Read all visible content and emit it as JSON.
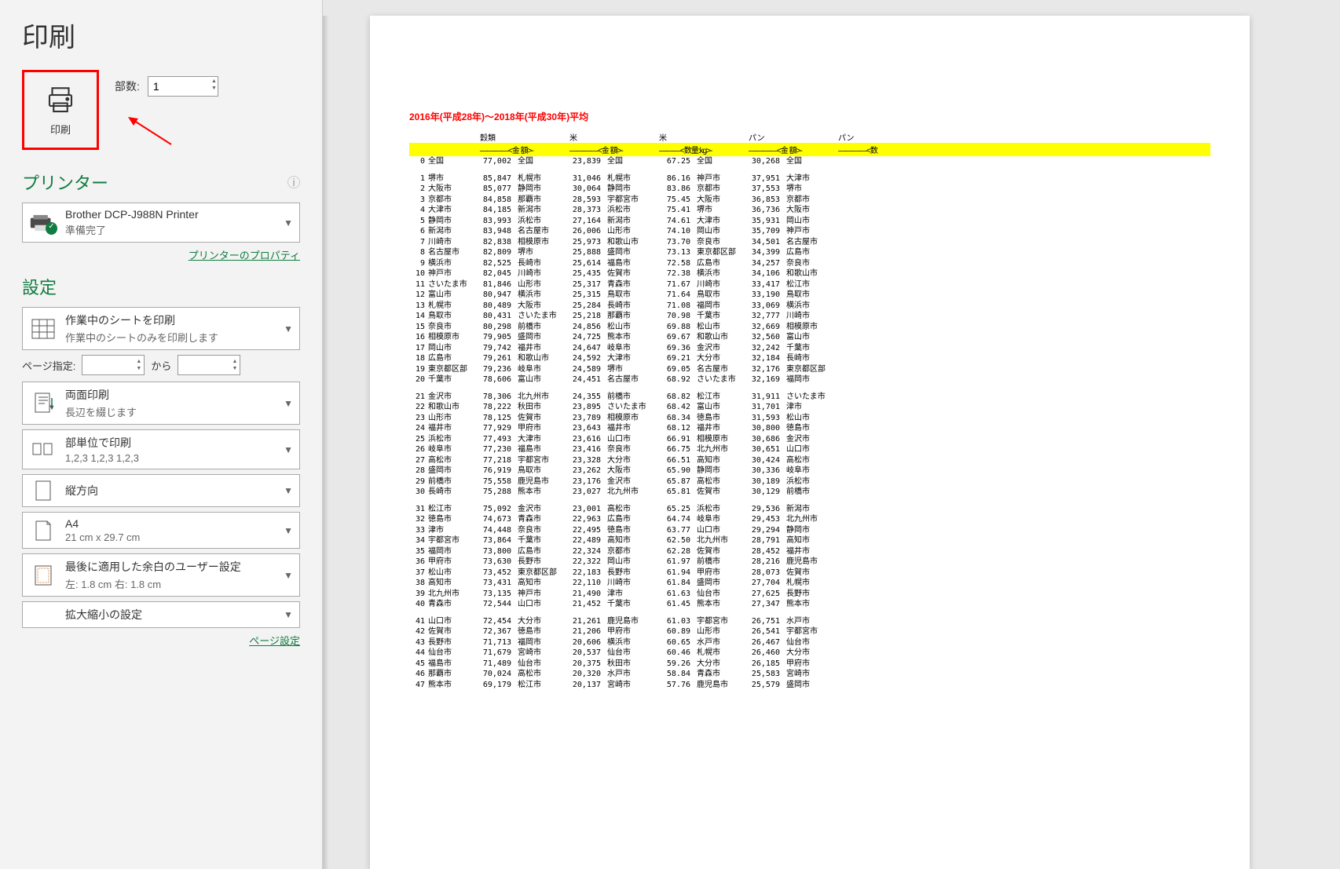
{
  "page_title": "印刷",
  "print_button_label": "印刷",
  "copies": {
    "label": "部数:",
    "value": "1"
  },
  "printer_section": {
    "title": "プリンター",
    "name": "Brother DCP-J988N Printer",
    "status": "準備完了",
    "properties_link": "プリンターのプロパティ"
  },
  "settings_section": {
    "title": "設定",
    "items": [
      {
        "title": "作業中のシートを印刷",
        "sub": "作業中のシートのみを印刷します"
      }
    ],
    "page_range": {
      "label": "ページ指定:",
      "to_label": "から",
      "from": "",
      "to": ""
    },
    "duplex": {
      "title": "両面印刷",
      "sub": "長辺を綴じます"
    },
    "collate": {
      "title": "部単位で印刷",
      "sub": "1,2,3    1,2,3    1,2,3"
    },
    "orientation": {
      "title": "縦方向"
    },
    "paper": {
      "title": "A4",
      "sub": "21 cm x 29.7 cm"
    },
    "margins": {
      "title": "最後に適用した余白のユーザー設定",
      "sub": "左:  1.8 cm    右:  1.8 cm"
    },
    "scaling": {
      "title": "拡大縮小の設定"
    },
    "page_setup_link": "ページ設定"
  },
  "report": {
    "title": "2016年(平成28年)～2018年(平成30年)平均",
    "header_top": [
      "穀類",
      "米",
      "米",
      "パン",
      "パン"
    ],
    "header_yellow": [
      "――――<金 額>-",
      "――――<金 額>-",
      "―――<数量:kg>-",
      "――――<金 額>-",
      "――――<数"
    ],
    "row0": {
      "n": "0",
      "c1": "全国",
      "v1": "77,002",
      "c2": "全国",
      "v2": "23,839",
      "c3": "全国",
      "v3": "67.25",
      "c4": "全国",
      "v4": "30,268",
      "c5": "全国"
    },
    "groups": [
      [
        {
          "n": "1",
          "c1": "堺市",
          "v1": "85,847",
          "c2": "札幌市",
          "v2": "31,046",
          "c3": "札幌市",
          "v3": "86.16",
          "c4": "神戸市",
          "v4": "37,951",
          "c5": "大津市"
        },
        {
          "n": "2",
          "c1": "大阪市",
          "v1": "85,077",
          "c2": "静岡市",
          "v2": "30,064",
          "c3": "静岡市",
          "v3": "83.86",
          "c4": "京都市",
          "v4": "37,553",
          "c5": "堺市"
        },
        {
          "n": "3",
          "c1": "京都市",
          "v1": "84,858",
          "c2": "那覇市",
          "v2": "28,593",
          "c3": "宇都宮市",
          "v3": "75.45",
          "c4": "大阪市",
          "v4": "36,853",
          "c5": "京都市"
        },
        {
          "n": "4",
          "c1": "大津市",
          "v1": "84,185",
          "c2": "新潟市",
          "v2": "28,373",
          "c3": "浜松市",
          "v3": "75.41",
          "c4": "堺市",
          "v4": "36,736",
          "c5": "大阪市"
        },
        {
          "n": "5",
          "c1": "静岡市",
          "v1": "83,993",
          "c2": "浜松市",
          "v2": "27,164",
          "c3": "新潟市",
          "v3": "74.61",
          "c4": "大津市",
          "v4": "35,931",
          "c5": "岡山市"
        },
        {
          "n": "6",
          "c1": "新潟市",
          "v1": "83,948",
          "c2": "名古屋市",
          "v2": "26,006",
          "c3": "山形市",
          "v3": "74.10",
          "c4": "岡山市",
          "v4": "35,709",
          "c5": "神戸市"
        },
        {
          "n": "7",
          "c1": "川崎市",
          "v1": "82,838",
          "c2": "相模原市",
          "v2": "25,973",
          "c3": "和歌山市",
          "v3": "73.70",
          "c4": "奈良市",
          "v4": "34,501",
          "c5": "名古屋市"
        },
        {
          "n": "8",
          "c1": "名古屋市",
          "v1": "82,809",
          "c2": "堺市",
          "v2": "25,888",
          "c3": "盛岡市",
          "v3": "73.13",
          "c4": "東京都区部",
          "v4": "34,399",
          "c5": "広島市"
        },
        {
          "n": "9",
          "c1": "横浜市",
          "v1": "82,525",
          "c2": "長崎市",
          "v2": "25,614",
          "c3": "福島市",
          "v3": "72.58",
          "c4": "広島市",
          "v4": "34,257",
          "c5": "奈良市"
        },
        {
          "n": "10",
          "c1": "神戸市",
          "v1": "82,045",
          "c2": "川崎市",
          "v2": "25,435",
          "c3": "佐賀市",
          "v3": "72.38",
          "c4": "横浜市",
          "v4": "34,106",
          "c5": "和歌山市"
        },
        {
          "n": "11",
          "c1": "さいたま市",
          "v1": "81,846",
          "c2": "山形市",
          "v2": "25,317",
          "c3": "青森市",
          "v3": "71.67",
          "c4": "川崎市",
          "v4": "33,417",
          "c5": "松江市"
        },
        {
          "n": "12",
          "c1": "富山市",
          "v1": "80,947",
          "c2": "横浜市",
          "v2": "25,315",
          "c3": "鳥取市",
          "v3": "71.64",
          "c4": "鳥取市",
          "v4": "33,190",
          "c5": "鳥取市"
        },
        {
          "n": "13",
          "c1": "札幌市",
          "v1": "80,489",
          "c2": "大阪市",
          "v2": "25,284",
          "c3": "長崎市",
          "v3": "71.08",
          "c4": "福岡市",
          "v4": "33,069",
          "c5": "横浜市"
        },
        {
          "n": "14",
          "c1": "鳥取市",
          "v1": "80,431",
          "c2": "さいたま市",
          "v2": "25,218",
          "c3": "那覇市",
          "v3": "70.98",
          "c4": "千葉市",
          "v4": "32,777",
          "c5": "川崎市"
        },
        {
          "n": "15",
          "c1": "奈良市",
          "v1": "80,298",
          "c2": "前橋市",
          "v2": "24,856",
          "c3": "松山市",
          "v3": "69.88",
          "c4": "松山市",
          "v4": "32,669",
          "c5": "相模原市"
        },
        {
          "n": "16",
          "c1": "相模原市",
          "v1": "79,905",
          "c2": "盛岡市",
          "v2": "24,725",
          "c3": "熊本市",
          "v3": "69.67",
          "c4": "和歌山市",
          "v4": "32,560",
          "c5": "富山市"
        },
        {
          "n": "17",
          "c1": "岡山市",
          "v1": "79,742",
          "c2": "福井市",
          "v2": "24,647",
          "c3": "岐阜市",
          "v3": "69.36",
          "c4": "金沢市",
          "v4": "32,242",
          "c5": "千葉市"
        },
        {
          "n": "18",
          "c1": "広島市",
          "v1": "79,261",
          "c2": "和歌山市",
          "v2": "24,592",
          "c3": "大津市",
          "v3": "69.21",
          "c4": "大分市",
          "v4": "32,184",
          "c5": "長崎市"
        },
        {
          "n": "19",
          "c1": "東京都区部",
          "v1": "79,236",
          "c2": "岐阜市",
          "v2": "24,589",
          "c3": "堺市",
          "v3": "69.05",
          "c4": "名古屋市",
          "v4": "32,176",
          "c5": "東京都区部"
        },
        {
          "n": "20",
          "c1": "千葉市",
          "v1": "78,606",
          "c2": "富山市",
          "v2": "24,451",
          "c3": "名古屋市",
          "v3": "68.92",
          "c4": "さいたま市",
          "v4": "32,169",
          "c5": "福岡市"
        }
      ],
      [
        {
          "n": "21",
          "c1": "金沢市",
          "v1": "78,306",
          "c2": "北九州市",
          "v2": "24,355",
          "c3": "前橋市",
          "v3": "68.82",
          "c4": "松江市",
          "v4": "31,911",
          "c5": "さいたま市"
        },
        {
          "n": "22",
          "c1": "和歌山市",
          "v1": "78,222",
          "c2": "秋田市",
          "v2": "23,895",
          "c3": "さいたま市",
          "v3": "68.42",
          "c4": "富山市",
          "v4": "31,701",
          "c5": "津市"
        },
        {
          "n": "23",
          "c1": "山形市",
          "v1": "78,125",
          "c2": "佐賀市",
          "v2": "23,789",
          "c3": "相模原市",
          "v3": "68.34",
          "c4": "徳島市",
          "v4": "31,593",
          "c5": "松山市"
        },
        {
          "n": "24",
          "c1": "福井市",
          "v1": "77,929",
          "c2": "甲府市",
          "v2": "23,643",
          "c3": "福井市",
          "v3": "68.12",
          "c4": "福井市",
          "v4": "30,800",
          "c5": "徳島市"
        },
        {
          "n": "25",
          "c1": "浜松市",
          "v1": "77,493",
          "c2": "大津市",
          "v2": "23,616",
          "c3": "山口市",
          "v3": "66.91",
          "c4": "相模原市",
          "v4": "30,686",
          "c5": "金沢市"
        },
        {
          "n": "26",
          "c1": "岐阜市",
          "v1": "77,230",
          "c2": "福島市",
          "v2": "23,416",
          "c3": "奈良市",
          "v3": "66.75",
          "c4": "北九州市",
          "v4": "30,651",
          "c5": "山口市"
        },
        {
          "n": "27",
          "c1": "高松市",
          "v1": "77,218",
          "c2": "宇都宮市",
          "v2": "23,328",
          "c3": "大分市",
          "v3": "66.51",
          "c4": "高知市",
          "v4": "30,424",
          "c5": "高松市"
        },
        {
          "n": "28",
          "c1": "盛岡市",
          "v1": "76,919",
          "c2": "鳥取市",
          "v2": "23,262",
          "c3": "大阪市",
          "v3": "65.90",
          "c4": "静岡市",
          "v4": "30,336",
          "c5": "岐阜市"
        },
        {
          "n": "29",
          "c1": "前橋市",
          "v1": "75,558",
          "c2": "鹿児島市",
          "v2": "23,176",
          "c3": "金沢市",
          "v3": "65.87",
          "c4": "高松市",
          "v4": "30,189",
          "c5": "浜松市"
        },
        {
          "n": "30",
          "c1": "長崎市",
          "v1": "75,288",
          "c2": "熊本市",
          "v2": "23,027",
          "c3": "北九州市",
          "v3": "65.81",
          "c4": "佐賀市",
          "v4": "30,129",
          "c5": "前橋市"
        }
      ],
      [
        {
          "n": "31",
          "c1": "松江市",
          "v1": "75,092",
          "c2": "金沢市",
          "v2": "23,001",
          "c3": "高松市",
          "v3": "65.25",
          "c4": "浜松市",
          "v4": "29,536",
          "c5": "新潟市"
        },
        {
          "n": "32",
          "c1": "徳島市",
          "v1": "74,673",
          "c2": "青森市",
          "v2": "22,963",
          "c3": "広島市",
          "v3": "64.74",
          "c4": "岐阜市",
          "v4": "29,453",
          "c5": "北九州市"
        },
        {
          "n": "33",
          "c1": "津市",
          "v1": "74,448",
          "c2": "奈良市",
          "v2": "22,495",
          "c3": "徳島市",
          "v3": "63.77",
          "c4": "山口市",
          "v4": "29,294",
          "c5": "静岡市"
        },
        {
          "n": "34",
          "c1": "宇都宮市",
          "v1": "73,864",
          "c2": "千葉市",
          "v2": "22,489",
          "c3": "高知市",
          "v3": "62.50",
          "c4": "北九州市",
          "v4": "28,791",
          "c5": "高知市"
        },
        {
          "n": "35",
          "c1": "福岡市",
          "v1": "73,800",
          "c2": "広島市",
          "v2": "22,324",
          "c3": "京都市",
          "v3": "62.28",
          "c4": "佐賀市",
          "v4": "28,452",
          "c5": "福井市"
        },
        {
          "n": "36",
          "c1": "甲府市",
          "v1": "73,630",
          "c2": "長野市",
          "v2": "22,322",
          "c3": "岡山市",
          "v3": "61.97",
          "c4": "前橋市",
          "v4": "28,216",
          "c5": "鹿児島市"
        },
        {
          "n": "37",
          "c1": "松山市",
          "v1": "73,452",
          "c2": "東京都区部",
          "v2": "22,183",
          "c3": "長野市",
          "v3": "61.94",
          "c4": "甲府市",
          "v4": "28,073",
          "c5": "佐賀市"
        },
        {
          "n": "38",
          "c1": "高知市",
          "v1": "73,431",
          "c2": "高知市",
          "v2": "22,110",
          "c3": "川崎市",
          "v3": "61.84",
          "c4": "盛岡市",
          "v4": "27,704",
          "c5": "札幌市"
        },
        {
          "n": "39",
          "c1": "北九州市",
          "v1": "73,135",
          "c2": "神戸市",
          "v2": "21,490",
          "c3": "津市",
          "v3": "61.63",
          "c4": "仙台市",
          "v4": "27,625",
          "c5": "長野市"
        },
        {
          "n": "40",
          "c1": "青森市",
          "v1": "72,544",
          "c2": "山口市",
          "v2": "21,452",
          "c3": "千葉市",
          "v3": "61.45",
          "c4": "熊本市",
          "v4": "27,347",
          "c5": "熊本市"
        }
      ],
      [
        {
          "n": "41",
          "c1": "山口市",
          "v1": "72,454",
          "c2": "大分市",
          "v2": "21,261",
          "c3": "鹿児島市",
          "v3": "61.03",
          "c4": "宇都宮市",
          "v4": "26,751",
          "c5": "水戸市"
        },
        {
          "n": "42",
          "c1": "佐賀市",
          "v1": "72,367",
          "c2": "徳島市",
          "v2": "21,206",
          "c3": "甲府市",
          "v3": "60.89",
          "c4": "山形市",
          "v4": "26,541",
          "c5": "宇都宮市"
        },
        {
          "n": "43",
          "c1": "長野市",
          "v1": "71,713",
          "c2": "福岡市",
          "v2": "20,606",
          "c3": "横浜市",
          "v3": "60.65",
          "c4": "水戸市",
          "v4": "26,467",
          "c5": "仙台市"
        },
        {
          "n": "44",
          "c1": "仙台市",
          "v1": "71,679",
          "c2": "宮崎市",
          "v2": "20,537",
          "c3": "仙台市",
          "v3": "60.46",
          "c4": "札幌市",
          "v4": "26,460",
          "c5": "大分市"
        },
        {
          "n": "45",
          "c1": "福島市",
          "v1": "71,489",
          "c2": "仙台市",
          "v2": "20,375",
          "c3": "秋田市",
          "v3": "59.26",
          "c4": "大分市",
          "v4": "26,185",
          "c5": "甲府市"
        },
        {
          "n": "46",
          "c1": "那覇市",
          "v1": "70,024",
          "c2": "高松市",
          "v2": "20,320",
          "c3": "水戸市",
          "v3": "58.84",
          "c4": "青森市",
          "v4": "25,583",
          "c5": "宮崎市"
        },
        {
          "n": "47",
          "c1": "熊本市",
          "v1": "69,179",
          "c2": "松江市",
          "v2": "20,137",
          "c3": "宮崎市",
          "v3": "57.76",
          "c4": "鹿児島市",
          "v4": "25,579",
          "c5": "盛岡市"
        }
      ]
    ]
  }
}
